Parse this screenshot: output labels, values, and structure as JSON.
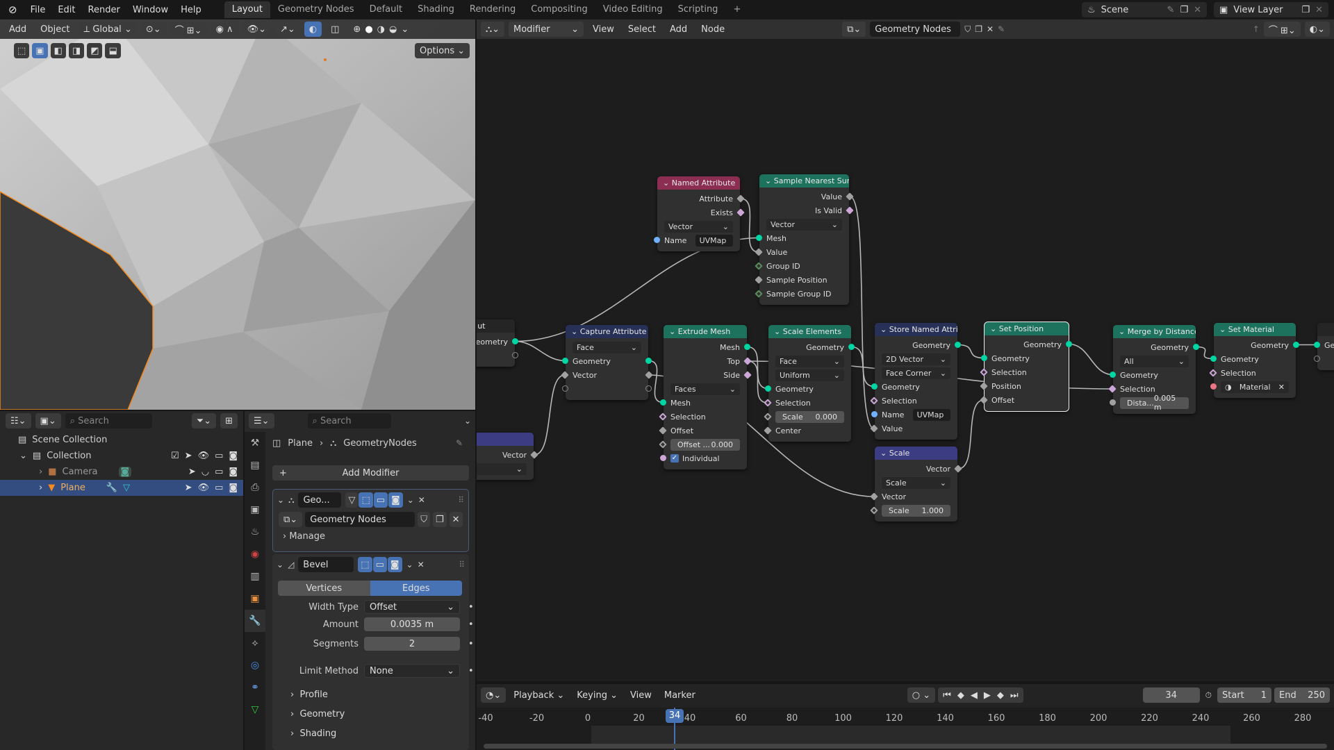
{
  "topbar": {
    "menus": [
      "File",
      "Edit",
      "Render",
      "Window",
      "Help"
    ],
    "workspaces": [
      "Layout",
      "Geometry Nodes",
      "Default",
      "Shading",
      "Rendering",
      "Compositing",
      "Video Editing",
      "Scripting"
    ],
    "active_workspace": "Layout",
    "add_tab": "+",
    "scene": "Scene",
    "view_layer": "View Layer"
  },
  "viewport": {
    "menus": [
      "Add",
      "Object"
    ],
    "orientation": "Global",
    "options": "Options",
    "selection_color": "#f28a1e"
  },
  "node_editor": {
    "editor_type": "Modifier",
    "menus": [
      "View",
      "Select",
      "Add",
      "Node"
    ],
    "node_tree": "Geometry Nodes",
    "nodes": {
      "group_input": {
        "title": "...ut",
        "rows": [
          {
            "t": "out",
            "label": "Geometry",
            "s": "geo"
          },
          {
            "t": "out",
            "label": "",
            "s": "empty"
          }
        ]
      },
      "vec_node": {
        "title": "",
        "rows": [
          {
            "t": "out",
            "label": "Vector",
            "s": "vec"
          },
          {
            "t": "sel",
            "label": ""
          }
        ]
      },
      "named_attr": {
        "title": "Named Attribute",
        "rows": [
          {
            "t": "out",
            "label": "Attribute",
            "s": "vec"
          },
          {
            "t": "out",
            "label": "Exists",
            "s": "bool"
          },
          {
            "t": "sel",
            "label": "Vector"
          },
          {
            "t": "txt",
            "label": "Name",
            "value": "UVMap",
            "s": "str"
          }
        ]
      },
      "sample_nearest": {
        "title": "Sample Nearest Surf...",
        "rows": [
          {
            "t": "out",
            "label": "Value",
            "s": "vec"
          },
          {
            "t": "out",
            "label": "Is Valid",
            "s": "bool"
          },
          {
            "t": "sel",
            "label": "Vector"
          },
          {
            "t": "in",
            "label": "Mesh",
            "s": "geo"
          },
          {
            "t": "in",
            "label": "Value",
            "s": "vec"
          },
          {
            "t": "in",
            "label": "Group ID",
            "s": "int"
          },
          {
            "t": "in",
            "label": "Sample Position",
            "s": "vec"
          },
          {
            "t": "in",
            "label": "Sample Group ID",
            "s": "int"
          }
        ]
      },
      "capture": {
        "title": "Capture Attribute",
        "rows": [
          {
            "t": "sel",
            "label": "Face"
          },
          {
            "t": "io",
            "label": "Geometry",
            "s": "geo"
          },
          {
            "t": "io",
            "label": "Vector",
            "s": "vec"
          },
          {
            "t": "io",
            "label": "",
            "s": "empty"
          }
        ]
      },
      "extrude": {
        "title": "Extrude Mesh",
        "rows": [
          {
            "t": "out",
            "label": "Mesh",
            "s": "geo"
          },
          {
            "t": "out",
            "label": "Top",
            "s": "bool"
          },
          {
            "t": "out",
            "label": "Side",
            "s": "bool"
          },
          {
            "t": "sel",
            "label": "Faces"
          },
          {
            "t": "in",
            "label": "Mesh",
            "s": "geo"
          },
          {
            "t": "in",
            "label": "Selection",
            "s": "boolh"
          },
          {
            "t": "in",
            "label": "Offset",
            "s": "vec"
          },
          {
            "t": "fld",
            "label": "Offset ...",
            "value": "0.000",
            "s": "floath"
          },
          {
            "t": "chk",
            "label": "Individual",
            "s": "boolc"
          }
        ]
      },
      "scale_el": {
        "title": "Scale Elements",
        "rows": [
          {
            "t": "out",
            "label": "Geometry",
            "s": "geo"
          },
          {
            "t": "sel",
            "label": "Face"
          },
          {
            "t": "sel",
            "label": "Uniform"
          },
          {
            "t": "in",
            "label": "Geometry",
            "s": "geo"
          },
          {
            "t": "in",
            "label": "Selection",
            "s": "boolh"
          },
          {
            "t": "fld",
            "label": "Scale",
            "value": "0.000",
            "s": "floath"
          },
          {
            "t": "in",
            "label": "Center",
            "s": "vec"
          }
        ]
      },
      "store": {
        "title": "Store Named Attrib...",
        "rows": [
          {
            "t": "out",
            "label": "Geometry",
            "s": "geo"
          },
          {
            "t": "sel",
            "label": "2D Vector"
          },
          {
            "t": "sel",
            "label": "Face Corner"
          },
          {
            "t": "in",
            "label": "Geometry",
            "s": "geo"
          },
          {
            "t": "in",
            "label": "Selection",
            "s": "boolh"
          },
          {
            "t": "txt",
            "label": "Name",
            "value": "UVMap",
            "s": "str"
          },
          {
            "t": "in",
            "label": "Value",
            "s": "vec"
          }
        ]
      },
      "scale": {
        "title": "Scale",
        "rows": [
          {
            "t": "out",
            "label": "Vector",
            "s": "vec"
          },
          {
            "t": "sel",
            "label": "Scale"
          },
          {
            "t": "in",
            "label": "Vector",
            "s": "vec"
          },
          {
            "t": "fld",
            "label": "Scale",
            "value": "1.000",
            "s": "floath"
          }
        ]
      },
      "set_pos": {
        "title": "Set Position",
        "rows": [
          {
            "t": "out",
            "label": "Geometry",
            "s": "geo"
          },
          {
            "t": "in",
            "label": "Geometry",
            "s": "geo"
          },
          {
            "t": "in",
            "label": "Selection",
            "s": "boolh"
          },
          {
            "t": "in",
            "label": "Position",
            "s": "vec"
          },
          {
            "t": "in",
            "label": "Offset",
            "s": "vec"
          }
        ]
      },
      "merge": {
        "title": "Merge by Distance",
        "rows": [
          {
            "t": "out",
            "label": "Geometry",
            "s": "geo"
          },
          {
            "t": "sel",
            "label": "All"
          },
          {
            "t": "in",
            "label": "Geometry",
            "s": "geo"
          },
          {
            "t": "in",
            "label": "Selection",
            "s": "bool"
          },
          {
            "t": "fld",
            "label": "Dista...",
            "value": "0.005 m",
            "s": "float"
          }
        ]
      },
      "set_mat": {
        "title": "Set Material",
        "rows": [
          {
            "t": "out",
            "label": "Geometry",
            "s": "geo"
          },
          {
            "t": "in",
            "label": "Geometry",
            "s": "geo"
          },
          {
            "t": "in",
            "label": "Selection",
            "s": "boolh"
          },
          {
            "t": "mat",
            "label": "Material",
            "s": "mat"
          }
        ]
      },
      "group_output": {
        "title": "",
        "rows": [
          {
            "t": "in",
            "label": "Ge",
            "s": "geo"
          },
          {
            "t": "in",
            "label": "",
            "s": "empty"
          }
        ]
      }
    },
    "header_colors": {
      "attribute": "#8c2d52",
      "geometry": "#1d725e",
      "vector": "#3c3c83",
      "capture": "#273056",
      "input": "#252525"
    },
    "socket_colors": {
      "geo": "#00d6a3",
      "vec": "#6363c7",
      "bool": "#cca6d6",
      "int": "#598c5c",
      "str": "#70b2ff",
      "float": "#a1a1a1",
      "mat": "#eb7582"
    }
  },
  "outliner": {
    "search_placeholder": "Search",
    "items": [
      {
        "label": "Scene Collection"
      },
      {
        "label": "Collection"
      },
      {
        "label": "Camera"
      },
      {
        "label": "Plane",
        "selected": true
      }
    ]
  },
  "properties": {
    "search_placeholder": "Search",
    "breadcrumb": [
      "Plane",
      "GeometryNodes"
    ],
    "add_modifier": "Add Modifier",
    "modifiers": [
      {
        "name": "Geo...",
        "node_group": "Geometry Nodes",
        "manage": "Manage"
      },
      {
        "name": "Bevel"
      }
    ],
    "bevel": {
      "affect": [
        "Vertices",
        "Edges"
      ],
      "affect_selected": "Edges",
      "fields": [
        {
          "label": "Width Type",
          "value": "Offset"
        },
        {
          "label": "Amount",
          "value": "0.0035 m"
        },
        {
          "label": "Segments",
          "value": "2"
        },
        {
          "label": "Limit Method",
          "value": "None"
        }
      ],
      "subpanels": [
        "Profile",
        "Geometry",
        "Shading"
      ]
    }
  },
  "timeline": {
    "menus": [
      "Playback",
      "Keying",
      "View",
      "Marker"
    ],
    "current_frame": "34",
    "start_label": "Start",
    "start": "1",
    "end_label": "End",
    "end": "250",
    "ticks": [
      "-40",
      "-20",
      "0",
      "20",
      "40",
      "60",
      "80",
      "100",
      "120",
      "140",
      "160",
      "180",
      "200",
      "220",
      "240",
      "260",
      "280"
    ]
  }
}
